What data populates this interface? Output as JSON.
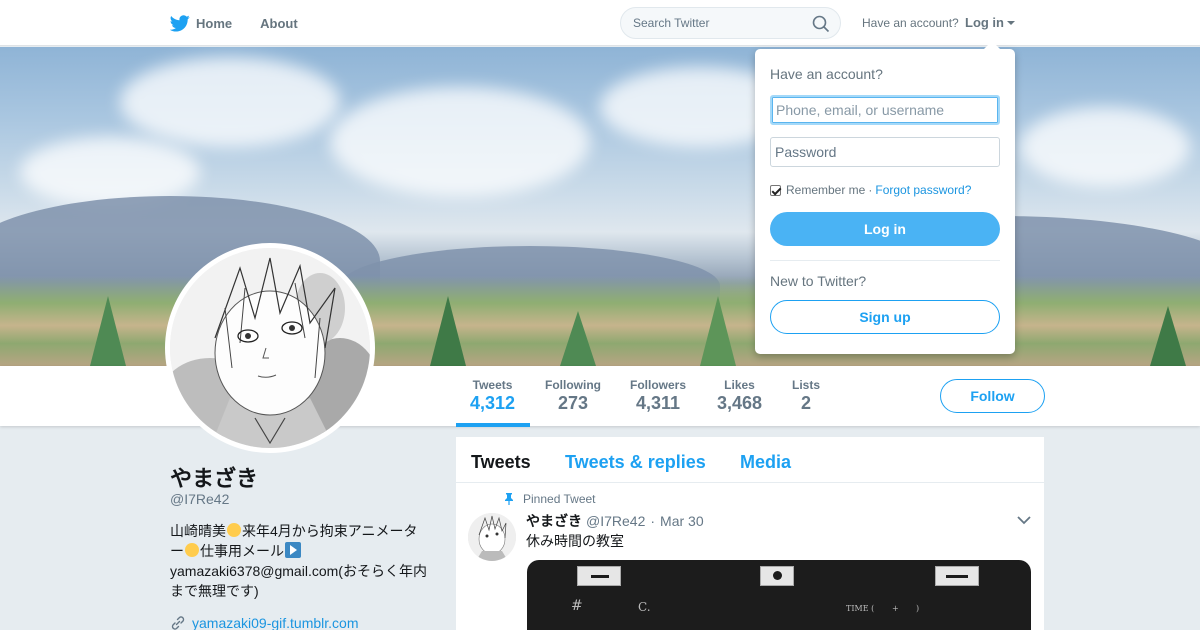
{
  "nav": {
    "home_label": "Home",
    "about_label": "About",
    "search_placeholder": "Search Twitter",
    "have_account": "Have an account?",
    "login_label": "Log in"
  },
  "profile": {
    "name": "やまざき",
    "handle": "@I7Re42",
    "bio_line1_a": "山崎晴美",
    "bio_line1_b": "来年4月から拘束アニメータ",
    "bio_line2_a": "ー",
    "bio_line2_b": "仕事用メール",
    "bio_line3": "yamazaki6378@gmail.com(おそらく年内",
    "bio_line4": "まで無理です)",
    "link": "yamazaki09-gif.tumblr.com"
  },
  "stats": [
    {
      "label": "Tweets",
      "value": "4,312",
      "active": true
    },
    {
      "label": "Following",
      "value": "273"
    },
    {
      "label": "Followers",
      "value": "4,311"
    },
    {
      "label": "Likes",
      "value": "3,468"
    },
    {
      "label": "Lists",
      "value": "2"
    }
  ],
  "follow_label": "Follow",
  "timeline": {
    "tabs": [
      "Tweets",
      "Tweets & replies",
      "Media"
    ],
    "pinned_label": "Pinned Tweet",
    "tweet": {
      "name": "やまざき",
      "handle": "@I7Re42",
      "date": "Mar 30",
      "text": "休み時間の教室",
      "media_text": {
        "hash": "#",
        "c": "C.",
        "time": "TIME (",
        "plus": "+",
        "paren": ")"
      }
    }
  },
  "login_dropdown": {
    "title": "Have an account?",
    "username_placeholder": "Phone, email, or username",
    "password_placeholder": "Password",
    "remember_label": "Remember me",
    "separator": "·",
    "forgot_label": "Forgot password?",
    "login_button": "Log in",
    "new_label": "New to Twitter?",
    "signup_button": "Sign up"
  },
  "colors": {
    "accent": "#1da1f2",
    "login_button": "#4ab3f4",
    "background": "#e6ecf0"
  },
  "icons": [
    "twitter-bird-icon",
    "search-icon",
    "caret-down-icon",
    "pin-icon",
    "link-icon",
    "chevron-down-icon"
  ]
}
